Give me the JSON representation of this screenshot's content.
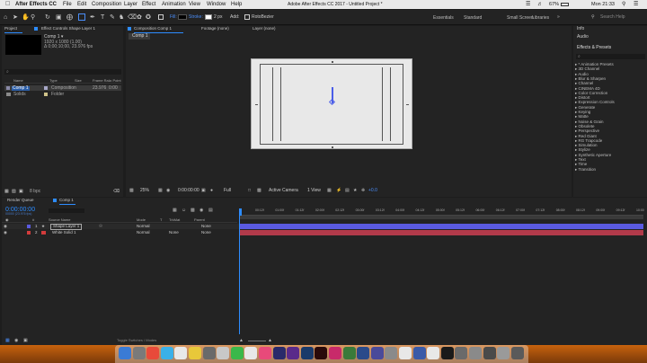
{
  "menubar": {
    "app": "After Effects CC",
    "items": [
      "File",
      "Edit",
      "Composition",
      "Layer",
      "Effect",
      "Animation",
      "View",
      "Window",
      "Help"
    ],
    "title": "Adobe After Effects CC 2017 - Untitled Project *",
    "battery": "67%",
    "clock": "Mon 21:33"
  },
  "toolbar": {
    "fill_label": "Fill:",
    "stroke_label": "Stroke:",
    "stroke_value": "2 px",
    "add_label": "Add:",
    "rotobezier_label": "RotoBezier",
    "workspaces": [
      "Essentials",
      "Standard",
      "Small Screen",
      "Libraries"
    ],
    "search_placeholder": "Search Help"
  },
  "project": {
    "tab": "Project",
    "effect_controls_tab": "Effect Controls Shape Layer 1",
    "comp_name": "Comp 1 ▾",
    "comp_size": "1920 x 1080 (1.00)",
    "comp_duration": "Δ 0;00;10;00, 23.976 fps",
    "search_placeholder": "⌕",
    "columns": [
      "Name",
      "Type",
      "Size",
      "Frame Ra...",
      "In Point"
    ],
    "rows": [
      {
        "name": "Comp 1",
        "type": "Composition",
        "size": "",
        "fps": "23.976",
        "in": "0:00"
      },
      {
        "name": "Solids",
        "type": "Folder",
        "size": "",
        "fps": "",
        "in": ""
      }
    ],
    "bpc": "8 bpc"
  },
  "composition": {
    "tab": "Composition Comp 1",
    "footage_tab": "Footage (none)",
    "layer_tab": "Layer (none)",
    "comp_tab": "Comp 1",
    "zoom": "25%",
    "timecode": "0:00:00:00",
    "resolution": "Full",
    "camera": "Active Camera",
    "views": "1 View",
    "exposure": "+0.0"
  },
  "right": {
    "info": "Info",
    "audio": "Audio",
    "effects_title": "Effects & Presets",
    "search_placeholder": "⌕",
    "items": [
      "* Animation Presets",
      "3D Channel",
      "Audio",
      "Blur & Sharpen",
      "Channel",
      "CINEMA 4D",
      "Color Correction",
      "Distort",
      "Expression Controls",
      "Generate",
      "Keying",
      "Matte",
      "Noise & Grain",
      "Obsolete",
      "Perspective",
      "Red Giant",
      "RG Trapcode",
      "Simulation",
      "Stylize",
      "Synthetic Aperture",
      "Text",
      "Time",
      "Transition"
    ]
  },
  "timeline": {
    "render_queue": "Render Queue",
    "comp_tab": "Comp 1",
    "timecode": "0:00:00:00",
    "fps_sub": "00000 (23.976 fps)",
    "columns": [
      "#",
      "Source Name",
      "Mode",
      "T",
      "TrkMat",
      "Parent"
    ],
    "layers": [
      {
        "num": "1",
        "name": "Shape Layer 1",
        "mode": "Normal",
        "trkmat": "",
        "parent": "None",
        "color": "#5a5ae0"
      },
      {
        "num": "2",
        "name": "White Solid 1",
        "mode": "Normal",
        "trkmat": "None",
        "parent": "None",
        "color": "#d23c3c"
      }
    ],
    "ruler": [
      "00:12f",
      "01:00f",
      "01:12f",
      "02:00f",
      "02:12f",
      "03:00f",
      "03:12f",
      "04:00f",
      "04:12f",
      "05:00f",
      "05:12f",
      "06:00f",
      "06:12f",
      "07:00f",
      "07:12f",
      "08:00f",
      "08:12f",
      "09:00f",
      "09:12f",
      "10:00"
    ],
    "toggle_label": "Toggle Switches / Modes"
  },
  "colors": {
    "accent": "#2d8cff",
    "layer1": "#5a5ae0",
    "layer2": "#d23c3c",
    "desktop": "#c7620d"
  }
}
